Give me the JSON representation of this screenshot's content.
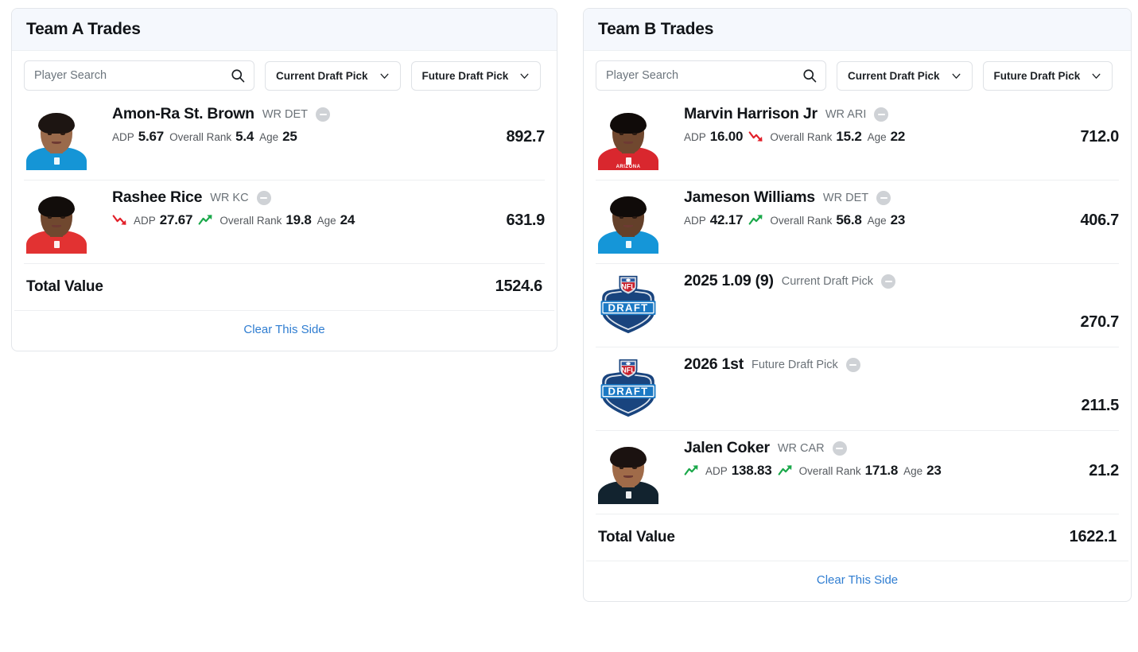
{
  "panels": [
    {
      "title": "Team A Trades",
      "search": {
        "placeholder": "Player Search",
        "value": ""
      },
      "dropdowns": [
        {
          "label": "Current Draft Pick"
        },
        {
          "label": "Future Draft Pick"
        }
      ],
      "assets": [
        {
          "kind": "player",
          "name": "Amon-Ra St. Brown",
          "meta": "WR DET",
          "value": "892.7",
          "stats": [
            {
              "label": "ADP",
              "value": "5.67",
              "trend": "none"
            },
            {
              "label": "Overall Rank",
              "value": "5.4",
              "trend": "none"
            },
            {
              "label": "Age",
              "value": "25",
              "trend": "none"
            }
          ],
          "photo": {
            "jersey": "#1595d6",
            "skin": "#9a6a4b",
            "hair": "#1d1512",
            "team_text": ""
          }
        },
        {
          "kind": "player",
          "name": "Rashee Rice",
          "meta": "WR KC",
          "value": "631.9",
          "stats": [
            {
              "label": "ADP",
              "value": "27.67",
              "trend": "down"
            },
            {
              "label": "Overall Rank",
              "value": "19.8",
              "trend": "up"
            },
            {
              "label": "Age",
              "value": "24",
              "trend": "none"
            }
          ],
          "photo": {
            "jersey": "#e23232",
            "skin": "#70482f",
            "hair": "#120d0b",
            "team_text": ""
          }
        }
      ],
      "total": {
        "label": "Total Value",
        "value": "1524.6"
      },
      "clear_label": "Clear This Side"
    },
    {
      "title": "Team B Trades",
      "search": {
        "placeholder": "Player Search",
        "value": ""
      },
      "dropdowns": [
        {
          "label": "Current Draft Pick"
        },
        {
          "label": "Future Draft Pick"
        }
      ],
      "assets": [
        {
          "kind": "player",
          "name": "Marvin Harrison Jr",
          "meta": "WR ARI",
          "value": "712.0",
          "stats": [
            {
              "label": "ADP",
              "value": "16.00",
              "trend": "none"
            },
            {
              "label": "Overall Rank",
              "value": "15.2",
              "trend": "down"
            },
            {
              "label": "Age",
              "value": "22",
              "trend": "none"
            }
          ],
          "photo": {
            "jersey": "#d9272e",
            "skin": "#70482f",
            "hair": "#100b09",
            "team_text": "ARIZONA"
          }
        },
        {
          "kind": "player",
          "name": "Jameson Williams",
          "meta": "WR DET",
          "value": "406.7",
          "stats": [
            {
              "label": "ADP",
              "value": "42.17",
              "trend": "none"
            },
            {
              "label": "Overall Rank",
              "value": "56.8",
              "trend": "up"
            },
            {
              "label": "Age",
              "value": "23",
              "trend": "none"
            }
          ],
          "photo": {
            "jersey": "#1596d8",
            "skin": "#64402a",
            "hair": "#100b09",
            "team_text": ""
          }
        },
        {
          "kind": "pick",
          "name": "2025 1.09 (9)",
          "meta": "Current Draft Pick",
          "value": "270.7",
          "stats": [],
          "logo": {
            "shield": "#19447e",
            "banner": "#1b79c4",
            "text": "DRAFT",
            "crest": "NFL"
          }
        },
        {
          "kind": "pick",
          "name": "2026 1st",
          "meta": "Future Draft Pick",
          "value": "211.5",
          "stats": [],
          "logo": {
            "shield": "#19447e",
            "banner": "#1b79c4",
            "text": "DRAFT",
            "crest": "NFL"
          }
        },
        {
          "kind": "player",
          "name": "Jalen Coker",
          "meta": "WR CAR",
          "value": "21.2",
          "stats": [
            {
              "label": "ADP",
              "value": "138.83",
              "trend": "up"
            },
            {
              "label": "Overall Rank",
              "value": "171.8",
              "trend": "up"
            },
            {
              "label": "Age",
              "value": "23",
              "trend": "none"
            }
          ],
          "photo": {
            "jersey": "#12232f",
            "skin": "#a06b49",
            "hair": "#1b1210",
            "team_text": ""
          }
        }
      ],
      "total": {
        "label": "Total Value",
        "value": "1622.1"
      },
      "clear_label": "Clear This Side"
    }
  ],
  "colors": {
    "accent_link": "#2f7dd1",
    "trend_up": "#1aa84a",
    "trend_down": "#e2202a",
    "header_bg": "#f5f8fd",
    "remove_btn": "#cfd2d6"
  }
}
